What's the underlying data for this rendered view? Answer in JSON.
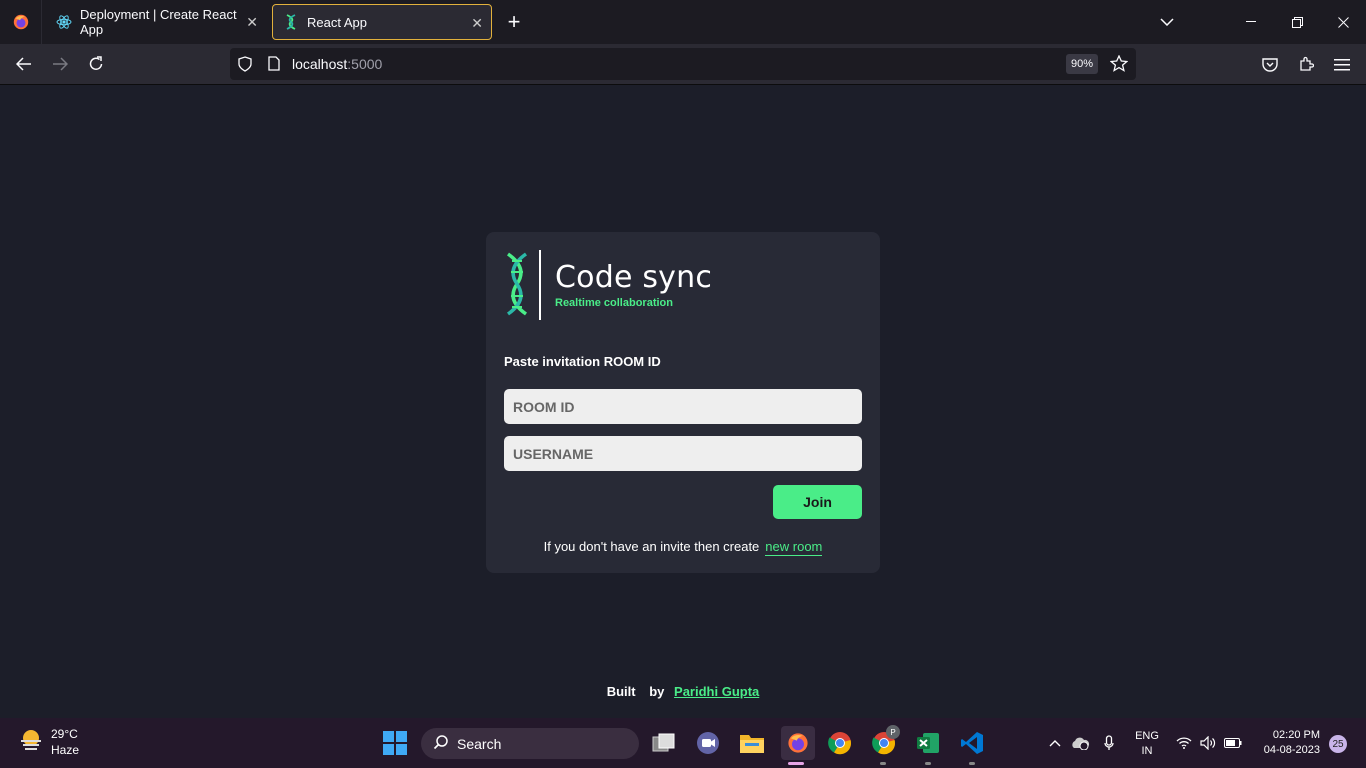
{
  "browser": {
    "tabs": [
      {
        "title": "Deployment | Create React App",
        "favicon": "react-icon"
      },
      {
        "title": "React App",
        "favicon": "dna-icon",
        "active": true
      }
    ],
    "url_host": "localhost",
    "url_port": ":5000",
    "zoom": "90%"
  },
  "card": {
    "app_name": "Code sync",
    "tagline": "Realtime collaboration",
    "label": "Paste invitation ROOM ID",
    "room_placeholder": "ROOM ID",
    "username_placeholder": "USERNAME",
    "join_label": "Join",
    "invite_text": "If you don't have an invite then create",
    "new_room_link": "new room"
  },
  "footer": {
    "built": "Built",
    "by": "by",
    "author": "Paridhi Gupta"
  },
  "taskbar": {
    "weather_temp": "29°C",
    "weather_desc": "Haze",
    "search_label": "Search",
    "lang": "ENG",
    "region": "IN",
    "time": "02:20 PM",
    "date": "04-08-2023",
    "notifications": "25",
    "chrome_profile_badge": "P"
  },
  "colors": {
    "accent": "#4aed88",
    "card_bg": "#282a36",
    "page_bg": "#1c1e29"
  }
}
